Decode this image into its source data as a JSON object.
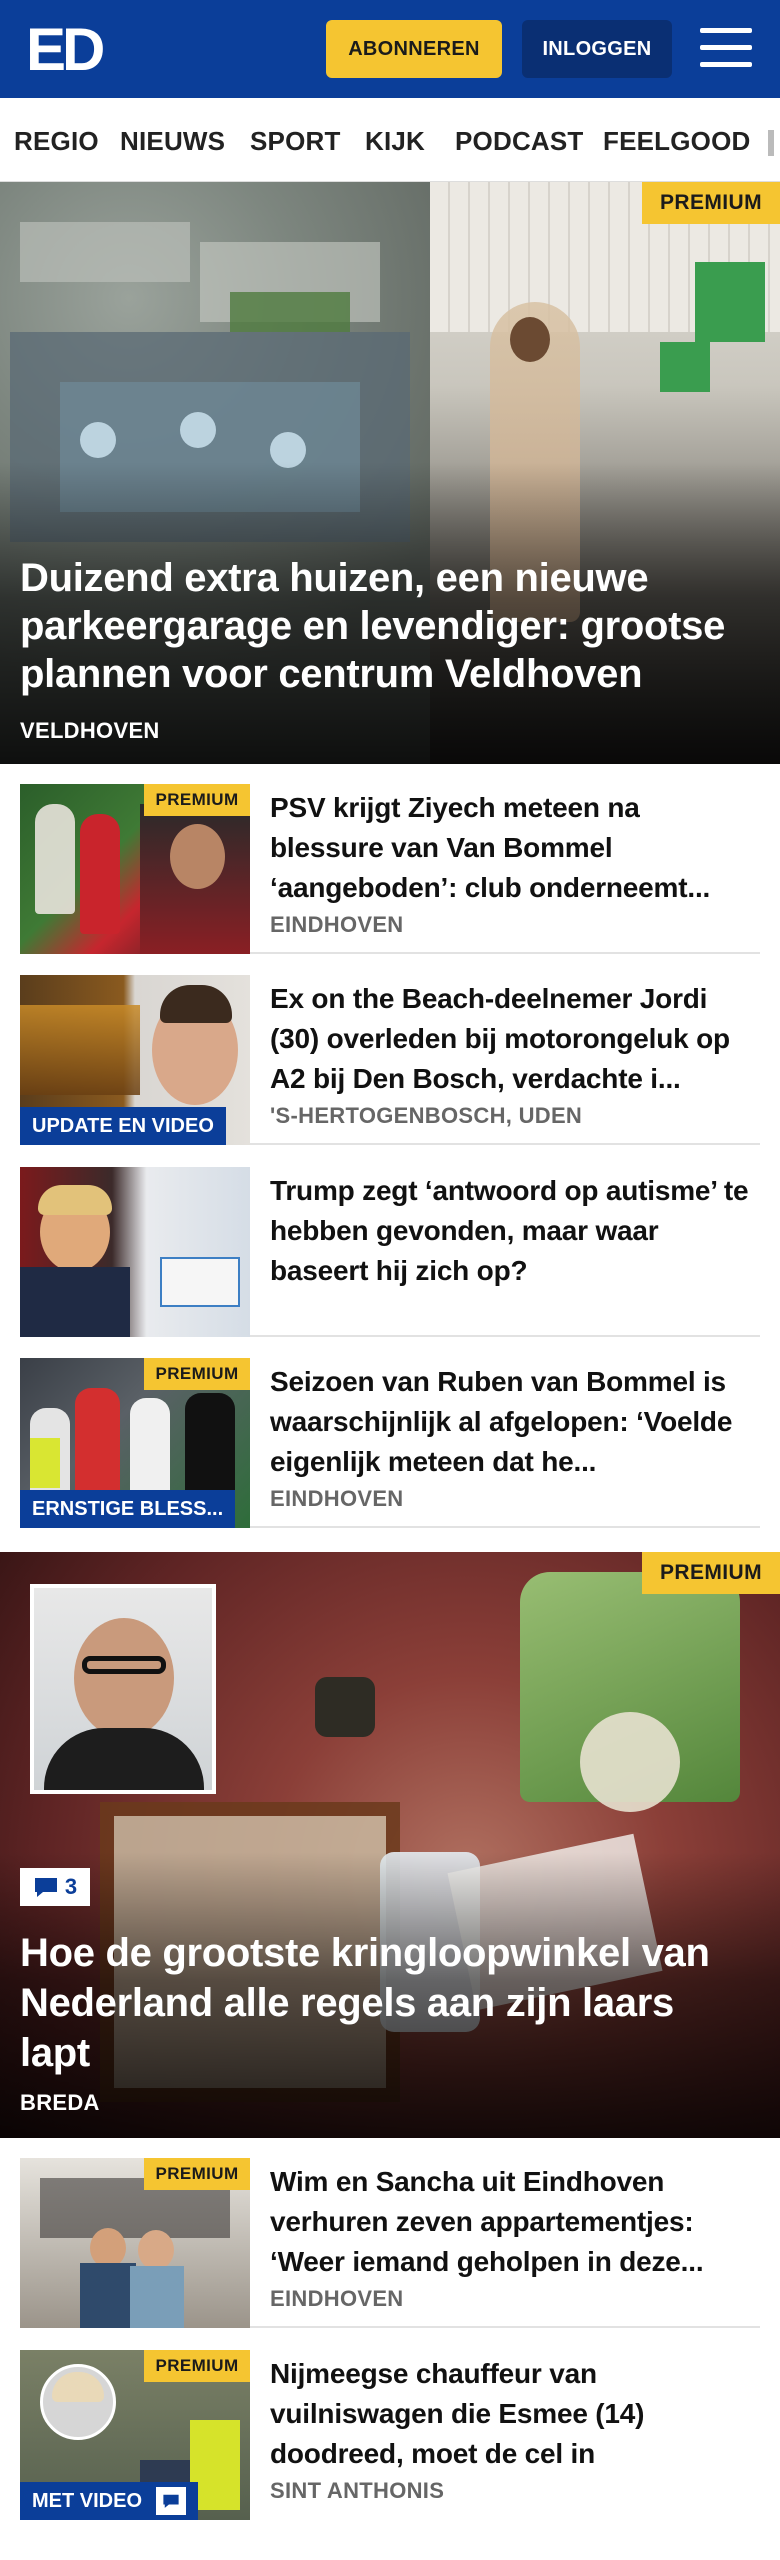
{
  "header": {
    "logo": "ED",
    "subscribe_label": "ABONNEREN",
    "login_label": "INLOGGEN",
    "colors": {
      "brand": "#0b3e99",
      "accent": "#f5c531"
    }
  },
  "nav": {
    "items": [
      "REGIO",
      "NIEUWS",
      "SPORT",
      "KIJK",
      "PODCAST",
      "FEELGOOD"
    ]
  },
  "hero": {
    "badge": "PREMIUM",
    "title": "Duizend extra huizen, een nieuwe parkeergarage en levendiger: grootse plannen voor centrum Veldhoven",
    "location": "VELDHOVEN"
  },
  "articles": [
    {
      "badge": "PREMIUM",
      "label": "",
      "title": "PSV krijgt Ziyech meteen na blessure van Van Bommel ‘aangeboden’: club onderneemt...",
      "location": "EINDHOVEN"
    },
    {
      "badge": "",
      "label": "UPDATE EN VIDEO",
      "title": "Ex on the Beach-deelnemer Jordi (30) overleden bij motorongeluk op A2 bij Den Bosch, verdachte i...",
      "location": "'S-HERTOGENBOSCH, UDEN"
    },
    {
      "badge": "",
      "label": "",
      "title": "Trump zegt ‘antwoord op autisme’ te hebben gevonden, maar waar baseert hij zich op?",
      "location": ""
    },
    {
      "badge": "PREMIUM",
      "label": "ERNSTIGE BLESS...",
      "title": "Seizoen van Ruben van Bommel is waarschijnlijk al afgelopen: ‘Voelde eigenlijk meteen dat he...",
      "location": "EINDHOVEN"
    }
  ],
  "big_story": {
    "badge": "PREMIUM",
    "comments": "3",
    "title": "Hoe de grootste kringloopwinkel van Nederland alle regels aan zijn laars lapt",
    "location": "BREDA"
  },
  "articles2": [
    {
      "badge": "PREMIUM",
      "label": "",
      "title": "Wim en Sancha uit Eindhoven verhuren zeven appartementjes: ‘Weer iemand geholpen in deze...",
      "location": "EINDHOVEN"
    },
    {
      "badge": "PREMIUM",
      "label": "MET VIDEO",
      "title": "Nijmeegse chauffeur van vuilniswagen die Esmee (14) doodreed, moet de cel in",
      "location": "SINT ANTHONIS"
    }
  ]
}
